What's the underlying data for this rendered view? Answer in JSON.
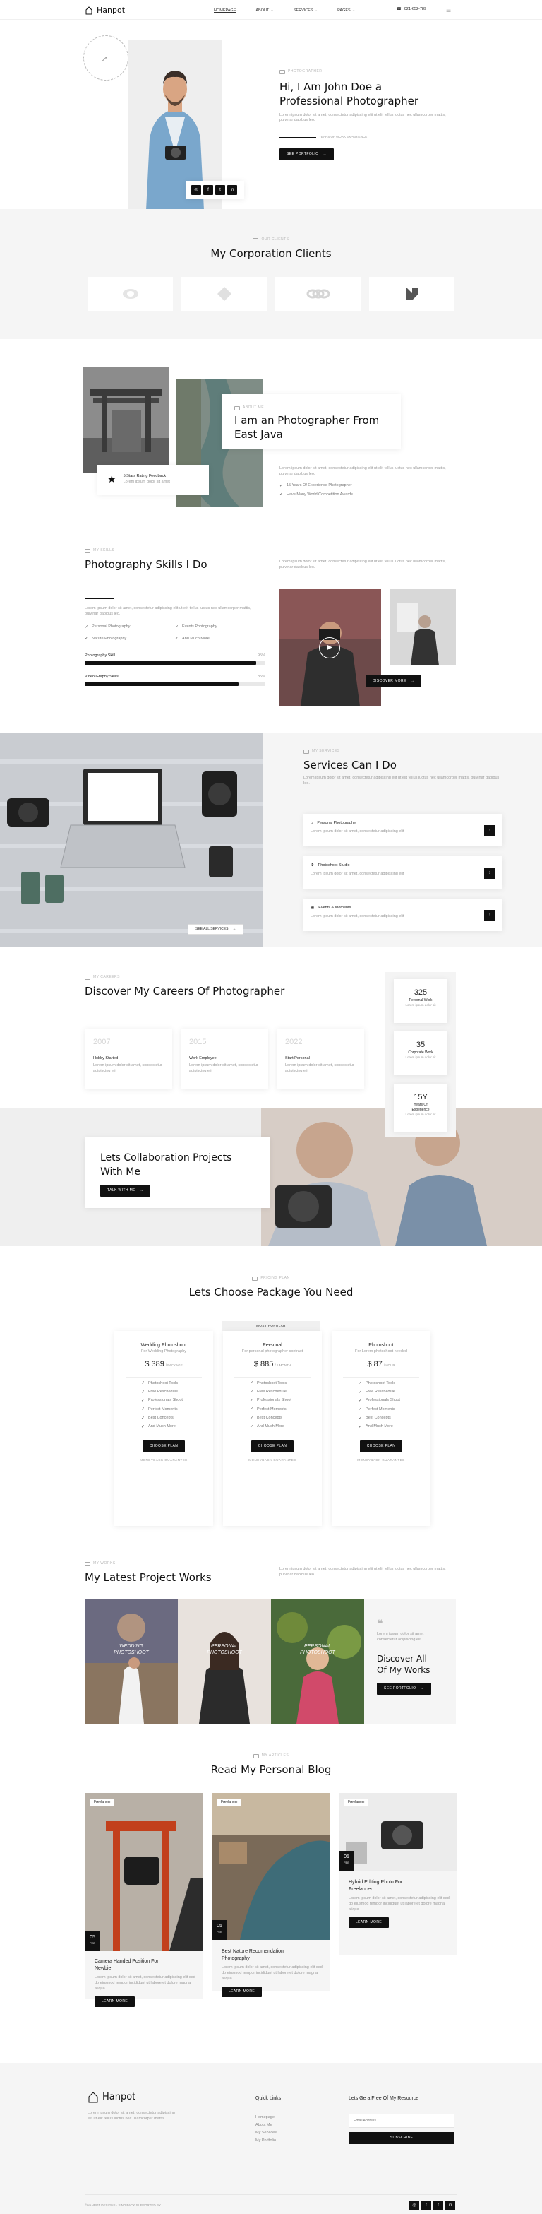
{
  "header": {
    "logo": "Hanpot",
    "nav": [
      "HOMEPAGE",
      "ABOUT",
      "SERVICES",
      "PAGES"
    ],
    "phone": "021-652-789"
  },
  "hero": {
    "tag": "PHOTOGRAPHER",
    "title1": "Hi, I Am John Doe a",
    "title2": "Professional Photographer",
    "text": "Lorem ipsum dolor sit amet, consectetur adipiscing elit ut elit tellus luctus nec ullamcorper mattis, pulvinar dapibus leo.",
    "years_label": "YEARS OF WORK EXPERIENCE",
    "button": "SEE PORTFOLIO"
  },
  "clients": {
    "tag": "OUR CLIENTS",
    "title": "My Corporation Clients"
  },
  "about": {
    "tag": "ABOUT ME",
    "title1": "I am an Photographer From",
    "title2": "East Java",
    "rating_title": "5 Stars Rating Feedback",
    "rating_text": "Lorem ipsum dolor sit amet",
    "text": "Lorem ipsum dolor sit amet, consectetur adipiscing elit ut elit tellus luctus nec ullamcorper mattis, pulvinar dapibus leo.",
    "points": [
      "15 Years Of Experience Photographer",
      "Have Many World Competition Awards"
    ]
  },
  "skills": {
    "tag": "MY SKILLS",
    "title": "Photography Skills I Do",
    "text_right": "Lorem ipsum dolor sit amet, consectetur adipiscing elit ut elit tellus luctus nec ullamcorper mattis, pulvinar dapibus leo.",
    "text": "Lorem ipsum dolor sit amet, consectetur adipiscing elit ut elit tellus luctus nec ullamcorper mattis, pulvinar dapibus leo.",
    "items": [
      "Personal Photography",
      "Events Photography",
      "Nature Photography",
      "And Much More"
    ],
    "bars": [
      {
        "label": "Photography Skill",
        "pct": 95
      },
      {
        "label": "Video Graphy Skills",
        "pct": 85
      }
    ],
    "button": "DISCOVER MORE"
  },
  "services": {
    "tag": "MY SERVICES",
    "title": "Services Can I Do",
    "text": "Lorem ipsum dolor sit amet, consectetur adipiscing elit ut elit tellus luctus nec ullamcorper mattis, pulvinar dapibus leo.",
    "list": [
      {
        "title": "Personal Photographer",
        "text": "Lorem ipsum dolor sit amet, consectetur adipiscing elit"
      },
      {
        "title": "Photoshoot Studio",
        "text": "Lorem ipsum dolor sit amet, consectetur adipiscing elit"
      },
      {
        "title": "Events & Moments",
        "text": "Lorem ipsum dolor sit amet, consectetur adipiscing elit"
      }
    ],
    "image_button": "SEE ALL SERVICES"
  },
  "careers": {
    "tag": "MY CAREERS",
    "title": "Discover My Careers Of Photographer",
    "items": [
      {
        "year": "2007",
        "title": "Hobby Started",
        "text": "Lorem ipsum dolor sit amet, consectetur adipiscing elit"
      },
      {
        "year": "2015",
        "title": "Work Employee",
        "text": "Lorem ipsum dolor sit amet, consectetur adipiscing elit"
      },
      {
        "year": "2022",
        "title": "Start Personal",
        "text": "Lorem ipsum dolor sit amet, consectetur adipiscing elit"
      }
    ],
    "stats": [
      {
        "num": "325",
        "label": "Personal Work",
        "text": "Lorem ipsum dolor sit"
      },
      {
        "num": "35",
        "label": "Corporate Work",
        "text": "Lorem ipsum dolor sit"
      },
      {
        "num": "15Y",
        "label": "Years Of Experience",
        "text": "Lorem ipsum dolor sit"
      }
    ],
    "collab1": "Lets Collaboration Projects",
    "collab2": "With Me",
    "collab_button": "TALK WITH ME"
  },
  "pricing": {
    "tag": "PRICING PLAN",
    "title": "Lets Choose Package You Need",
    "popular": "MOST POPULAR",
    "plans": [
      {
        "name": "Wedding Photoshoot",
        "sub": "For Wedding Photography",
        "price": "$ 389",
        "per": "/ PACKAGE"
      },
      {
        "name": "Personal",
        "sub": "For personal photographer contract",
        "price": "$ 885",
        "per": "/ 1 MONTH"
      },
      {
        "name": "Photoshoot",
        "sub": "For Lorem photoshoot needed",
        "price": "$ 87",
        "per": "/ HOUR"
      }
    ],
    "features": [
      "Photoshoot Tools",
      "Free Reschedule",
      "Professionals Shoot",
      "Perfect Moments",
      "Best Concepts",
      "And Much More"
    ],
    "button": "CHOOSE PLAN",
    "guarantee": "MONEYBACK GUARANTEE"
  },
  "works": {
    "tag": "MY WORKS",
    "title": "My Latest Project Works",
    "text": "Lorem ipsum dolor sit amet, consectetur adipiscing elit ut elit tellus luctus nec ullamcorper mattis, pulvinar dapibus leo.",
    "cards": [
      {
        "l1": "WEDDING",
        "l2": "PHOTOSHOOT"
      },
      {
        "l1": "PERSONAL",
        "l2": "PHOTOSHOOT"
      },
      {
        "l1": "PERSONAL",
        "l2": "PHOTOSHOOT"
      }
    ],
    "quote": "Lorem ipsum dolor sit amet consectetur adipiscing elit",
    "discover1": "Discover All",
    "discover2": "Of My Works",
    "button": "SEE PORTFOLIO"
  },
  "blog": {
    "tag": "MY ARTICLES",
    "title": "Read My Personal Blog",
    "posts": [
      {
        "cat": "Freelancer",
        "day": "05",
        "mon": "FEB",
        "t1": "Camera Handed Position For",
        "t2": "Newbie",
        "text": "Lorem ipsum dolor sit amet, consectetur adipiscing elit sed do eiusmod tempor incididunt ut labore et dolore magna aliqua.",
        "btn": "LEARN MORE"
      },
      {
        "cat": "Freelancer",
        "day": "05",
        "mon": "FEB",
        "t1": "Best Nature Recomendation",
        "t2": "Photography",
        "text": "Lorem ipsum dolor sit amet, consectetur adipiscing elit sed do eiusmod tempor incididunt ut labore et dolore magna aliqua.",
        "btn": "LEARN MORE"
      },
      {
        "cat": "Freelancer",
        "day": "05",
        "mon": "FEB",
        "t1": "Hybrid Editing Photo For",
        "t2": "Freelancer",
        "text": "Lorem ipsum dolor sit amet, consectetur adipiscing elit sed do eiusmod tempor incididunt ut labore et dolore magna aliqua.",
        "btn": "LEARN MORE"
      }
    ]
  },
  "footer": {
    "logo": "Hanpot",
    "text": "Lorem ipsum dolor sit amet, consectetur adipiscing elit ut elit tellus luctus nec ullamcorper mattis.",
    "links_title": "Quick Links",
    "links": [
      "Homepage",
      "About Me",
      "My Services",
      "My Portfolio"
    ],
    "sub_title": "Lets Ge a Free Of My Resource",
    "email_placeholder": "Email Address",
    "subscribe": "SUBSCRIBE",
    "copyright": "©HANPOT DESIGNS · SINDIPACK SUPPORTED BY"
  },
  "icons": {
    "arrow": "arrow-right-icon",
    "star": "star-icon",
    "play": "play-icon",
    "quote": "quote-icon"
  }
}
